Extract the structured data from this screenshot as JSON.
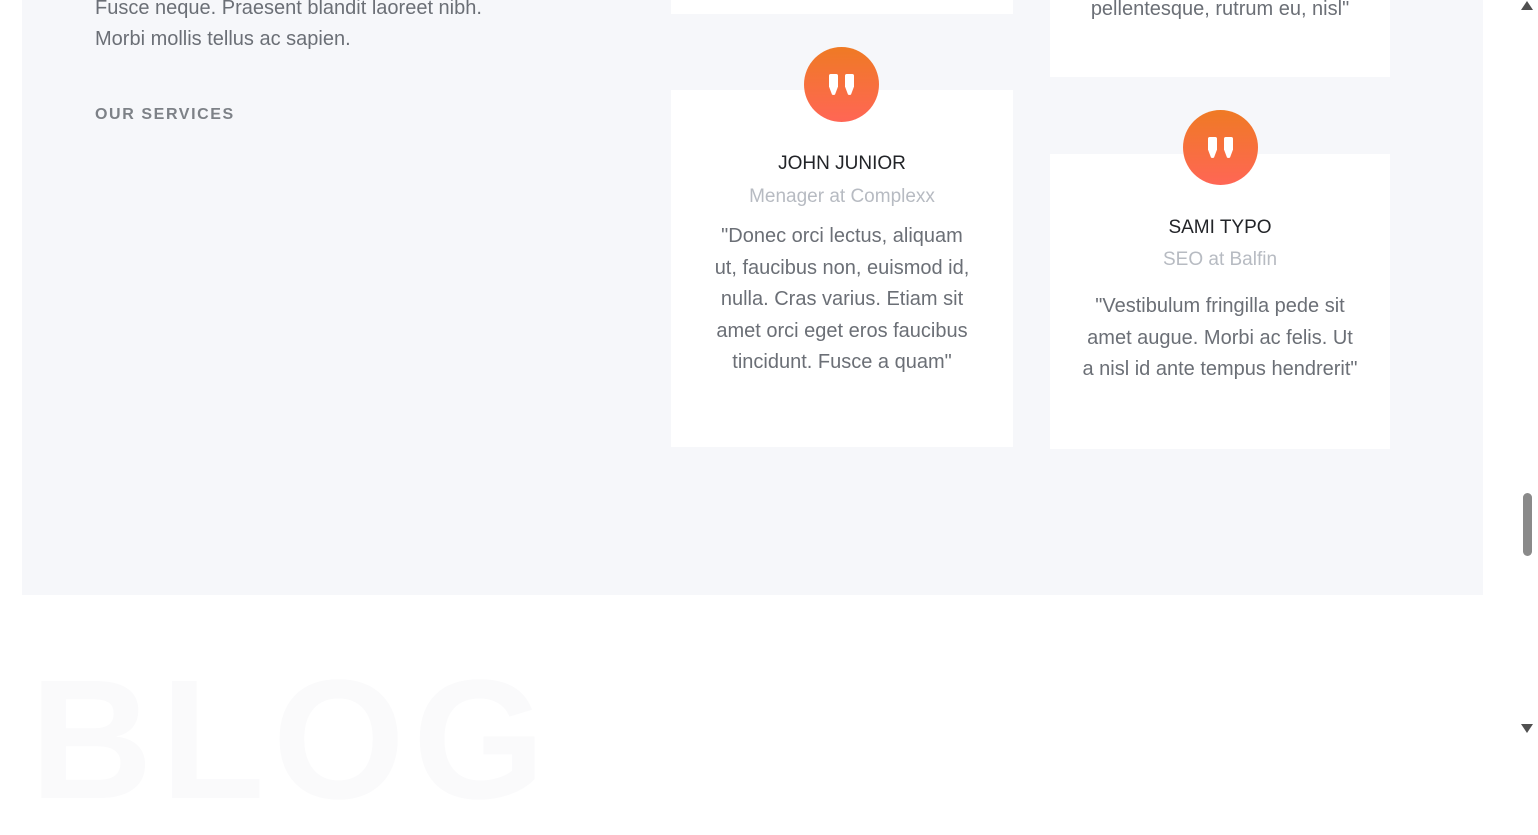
{
  "about": {
    "intro_text": "Fusce neque. Praesent blandit laoreet nibh. Morbi mollis tellus ac sapien.",
    "services_label": "OUR SERVICES"
  },
  "testimonials": {
    "accent_gradient": [
      "#ef7a24",
      "#ff6655"
    ],
    "quote_icon": "double-quote-icon",
    "cards": [
      {
        "quote": "pellentesque, rutrum eu, nisl\""
      },
      {
        "name": "JOHN JUNIOR",
        "role": "Menager at Complexx",
        "quote": "\"Donec orci lectus, aliquam ut, faucibus non, euismod id, nulla. Cras varius. Etiam sit amet orci eget eros faucibus tincidunt. Fusce a quam\""
      },
      {
        "name": "SAMI TYPO",
        "role": "SEO at Balfin",
        "quote": "\"Vestibulum fringilla pede sit amet augue. Morbi ac felis. Ut a nisl id ante tempus hendrerit\""
      }
    ]
  },
  "blog": {
    "heading": "BLOG"
  },
  "scrollbar": {
    "up_icon": "arrow-up-icon",
    "down_icon": "arrow-down-icon"
  }
}
